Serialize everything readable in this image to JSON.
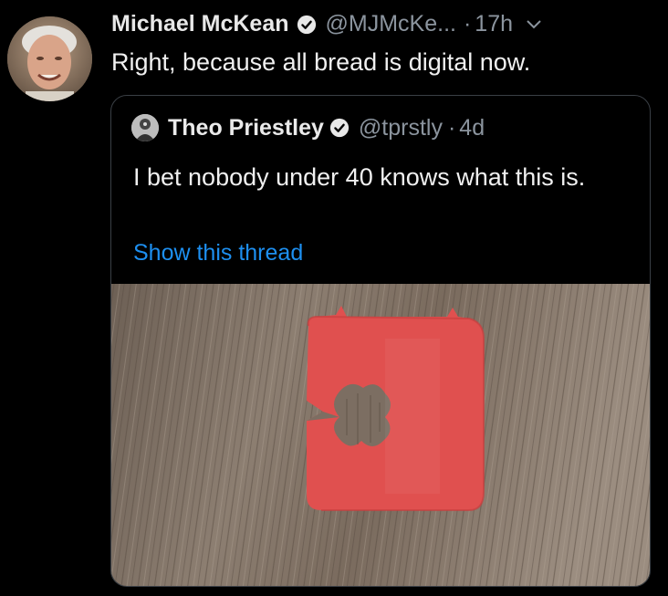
{
  "tweet": {
    "author_name": "Michael McKean",
    "author_handle": "@MJMcKe...",
    "separator": "·",
    "time": "17h",
    "text": "Right, because all bread is digital now.",
    "avatar_icon": "person-avatar",
    "verified_icon": "verified-badge-icon",
    "menu_icon": "chevron-down-icon"
  },
  "quoted_tweet": {
    "author_name": "Theo Priestley",
    "author_handle": "@tprstly",
    "separator": "·",
    "time": "4d",
    "text": "I bet nobody under 40 knows what this is.",
    "link_label": "Show this thread",
    "avatar_icon": "person-avatar",
    "verified_icon": "verified-badge-icon",
    "image_description_icon": "bread-clip-photo"
  },
  "colors": {
    "background": "#000000",
    "link": "#1d8ff0",
    "muted": "#8b949e",
    "border": "#3a3f45",
    "clip_red": "#e0504f"
  }
}
